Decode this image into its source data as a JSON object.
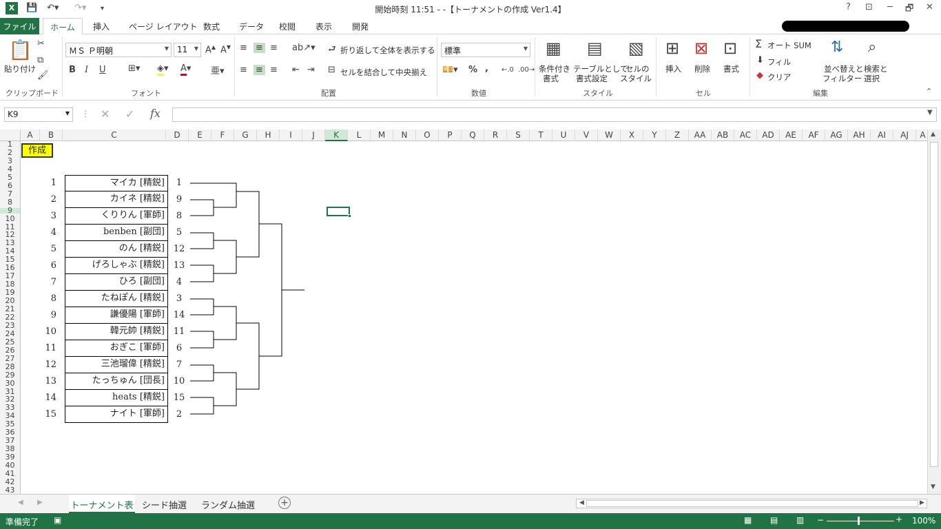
{
  "window": {
    "title": "開始時刻 11:51 - -【トーナメントの作成 Ver1.4】",
    "help": "?",
    "restore_ribbon": "⊡",
    "minimize": "─",
    "maximize": "🗗",
    "close": "✕"
  },
  "ribbon_tabs": [
    "ファイル",
    "ホーム",
    "挿入",
    "ページ レイアウト",
    "数式",
    "データ",
    "校閲",
    "表示",
    "開発"
  ],
  "ribbon": {
    "clipboard": {
      "paste": "貼り付け",
      "label": "クリップボード"
    },
    "font": {
      "name": "ＭＳ Ｐ明朝",
      "size": "11",
      "label": "フォント",
      "bold": "B",
      "italic": "I",
      "underline": "U"
    },
    "alignment": {
      "wrap": "折り返して全体を表示する",
      "merge": "セルを結合して中央揃え",
      "label": "配置"
    },
    "number": {
      "format": "標準",
      "label": "数値",
      "percent": "%",
      "comma": ","
    },
    "styles": {
      "conditional": [
        "条件付き",
        "書式"
      ],
      "table": [
        "テーブルとして",
        "書式設定"
      ],
      "cell": [
        "セルの",
        "スタイル"
      ],
      "label": "スタイル"
    },
    "cells": {
      "insert": "挿入",
      "delete": "削除",
      "format": "書式",
      "label": "セル"
    },
    "editing": {
      "autosum": "オート SUM",
      "fill": "フィル",
      "clear": "クリア",
      "sort": [
        "並べ替えと",
        "フィルター"
      ],
      "find": [
        "検索と",
        "選択"
      ],
      "label": "編集"
    }
  },
  "formula_bar": {
    "name_box": "K9",
    "fx": "fx",
    "value": ""
  },
  "columns": [
    "A",
    "B",
    "C",
    "D",
    "E",
    "F",
    "G",
    "H",
    "I",
    "J",
    "K",
    "L",
    "M",
    "N",
    "O",
    "P",
    "Q",
    "R",
    "S",
    "T",
    "U",
    "V",
    "W",
    "X",
    "Y",
    "Z",
    "AA",
    "AB",
    "AC",
    "AD",
    "AE",
    "AF",
    "AG",
    "AH",
    "AI",
    "AJ",
    "A"
  ],
  "rows": [
    "1",
    "2",
    "3",
    "4",
    "5",
    "6",
    "7",
    "8",
    "9",
    "10",
    "11",
    "12",
    "13",
    "14",
    "15",
    "16",
    "17",
    "18",
    "19",
    "20",
    "21",
    "22",
    "23",
    "24",
    "25",
    "26",
    "27",
    "28",
    "29",
    "30",
    "31",
    "32",
    "33",
    "34",
    "35",
    "36",
    "37",
    "38",
    "39",
    "40",
    "41",
    "42",
    "43"
  ],
  "create_button": "作成",
  "entries": [
    {
      "no": "1",
      "name": "マイカ [精鋭]",
      "seed": "1"
    },
    {
      "no": "2",
      "name": "カイネ [精鋭]",
      "seed": "9"
    },
    {
      "no": "3",
      "name": "くりりん [軍師]",
      "seed": "8"
    },
    {
      "no": "4",
      "name": "benben [副団]",
      "seed": "5"
    },
    {
      "no": "5",
      "name": "のん [精鋭]",
      "seed": "12"
    },
    {
      "no": "6",
      "name": "げろしゃぶ [精鋭]",
      "seed": "13"
    },
    {
      "no": "7",
      "name": "ひろ [副団]",
      "seed": "4"
    },
    {
      "no": "8",
      "name": "たねぽん [精鋭]",
      "seed": "3"
    },
    {
      "no": "9",
      "name": "謙優陽 [軍師]",
      "seed": "14"
    },
    {
      "no": "10",
      "name": "韓元帥 [精鋭]",
      "seed": "11"
    },
    {
      "no": "11",
      "name": "おぎこ [軍師]",
      "seed": "6"
    },
    {
      "no": "12",
      "name": "三池瑠偉 [精鋭]",
      "seed": "7"
    },
    {
      "no": "13",
      "name": "たっちゅん [団長]",
      "seed": "10"
    },
    {
      "no": "14",
      "name": "heats [精鋭]",
      "seed": "15"
    },
    {
      "no": "15",
      "name": "ナイト [軍師]",
      "seed": "2"
    }
  ],
  "sheet_tabs": [
    "トーナメント表",
    "シード抽選",
    "ランダム抽選"
  ],
  "status": {
    "ready": "準備完了",
    "zoom": "100%"
  },
  "colors": {
    "accent": "#217346",
    "button_yellow": "#ffff00"
  }
}
